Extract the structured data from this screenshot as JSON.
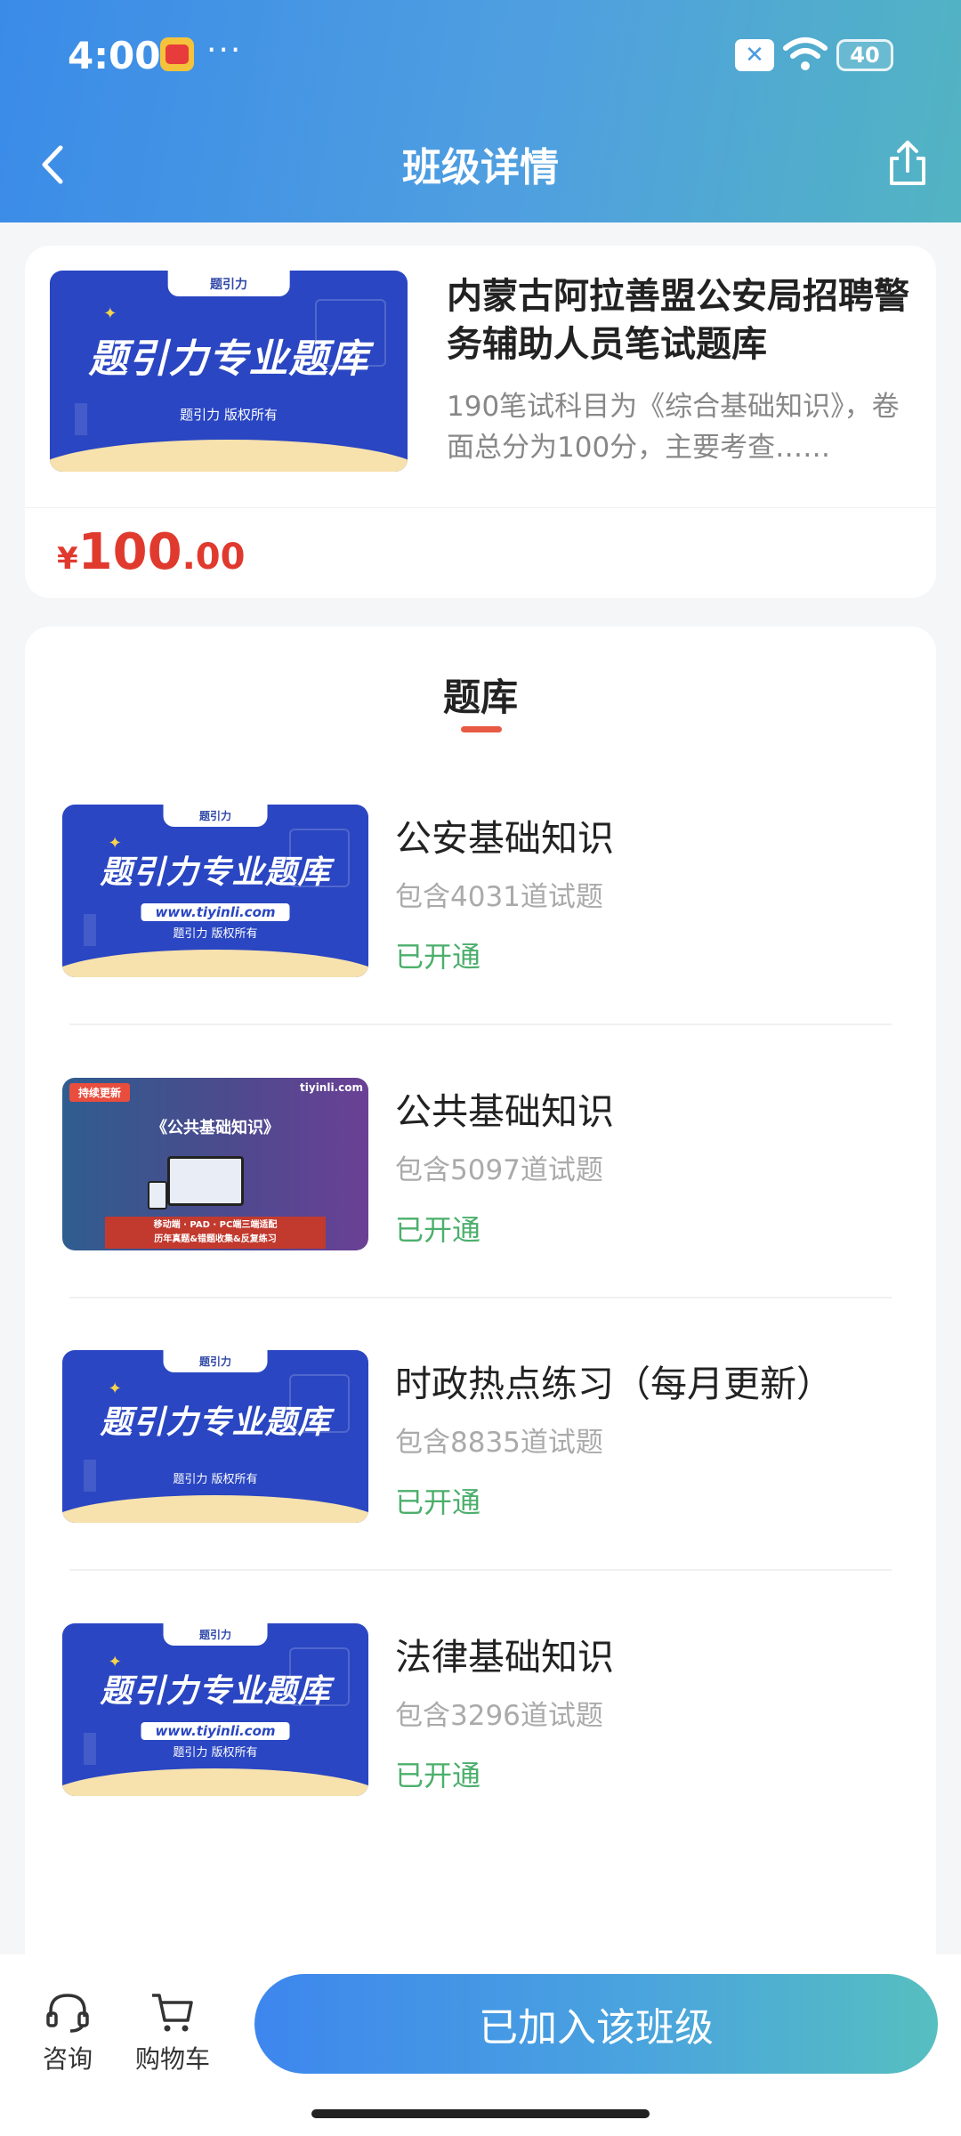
{
  "status_bar": {
    "time": "4:00",
    "app_badge_text": "618",
    "dots": "···",
    "battery": "40"
  },
  "header": {
    "title": "班级详情"
  },
  "course": {
    "cover": {
      "tab": "题引力",
      "headline": "题引力专业题库",
      "copyright": "题引力 版权所有"
    },
    "title": "内蒙古阿拉善盟公安局招聘警务辅助人员笔试题库",
    "description": "190笔试科目为《综合基础知识》，卷面总分为100分，主要考查……",
    "price": {
      "symbol": "¥",
      "integer": "100",
      "decimal": ".00"
    }
  },
  "bank": {
    "section_title": "题库",
    "items": [
      {
        "name": "公安基础知识",
        "count": "包含4031道试题",
        "status": "已开通",
        "cover": {
          "tab": "题引力",
          "headline": "题引力专业题库",
          "url": "www.tiyinli.com",
          "copyright": "题引力 版权所有"
        }
      },
      {
        "name": "公共基础知识",
        "count": "包含5097道试题",
        "status": "已开通",
        "cover": {
          "ribbon": "持续更新",
          "brand": "tiyinli.com",
          "title": "《公共基础知识》",
          "banner_line1": "移动端 · PAD · PC端三端适配",
          "banner_line2": "历年真题&错题收集&反复练习"
        }
      },
      {
        "name": "时政热点练习（每月更新）",
        "count": "包含8835道试题",
        "status": "已开通",
        "cover": {
          "tab": "题引力",
          "headline": "题引力专业题库",
          "copyright": "题引力 版权所有"
        }
      },
      {
        "name": "法律基础知识",
        "count": "包含3296道试题",
        "status": "已开通",
        "cover": {
          "tab": "题引力",
          "headline": "题引力专业题库",
          "url": "www.tiyinli.com",
          "copyright": "题引力 版权所有"
        }
      }
    ]
  },
  "bottom_bar": {
    "consult_label": "咨询",
    "cart_label": "购物车",
    "join_button": "已加入该班级"
  },
  "colors": {
    "accent_blue": "#3a8be8",
    "price_red": "#e03a2f",
    "status_green": "#4caf6c"
  }
}
